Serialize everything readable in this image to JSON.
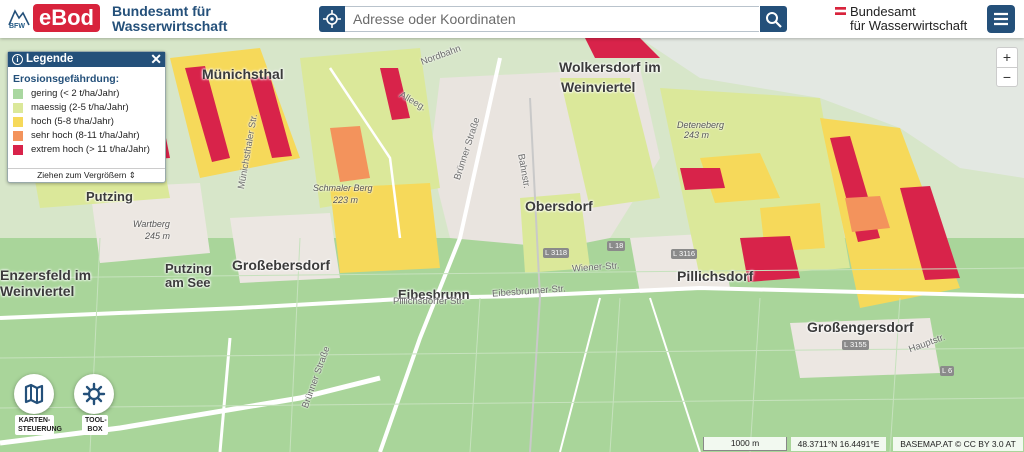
{
  "header": {
    "logo_small": "BFW",
    "app_badge": "eBod",
    "app_subtitle_line1": "Bundesamt für",
    "app_subtitle_line2": "Wasserwirtschaft",
    "search_placeholder": "Adresse oder Koordinaten",
    "agency_line1": "Bundesamt",
    "agency_line2": "für Wasserwirtschaft"
  },
  "legend": {
    "header": "Legende",
    "title": "Erosionsgefährdung:",
    "items": [
      {
        "label": "gering (< 2 t/ha/Jahr)",
        "color": "#a9d7a0"
      },
      {
        "label": "maessig (2-5 t/ha/Jahr)",
        "color": "#dbe89a"
      },
      {
        "label": "hoch (5-8 t/ha/Jahr)",
        "color": "#f6d95a"
      },
      {
        "label": "sehr hoch (8-11 t/ha/Jahr)",
        "color": "#f3935c"
      },
      {
        "label": "extrem hoch (> 11 t/ha/Jahr)",
        "color": "#d8234a"
      }
    ],
    "resize_label": "Ziehen zum Vergrößern"
  },
  "map": {
    "places": [
      "Münichsthal",
      "Wolkersdorf im",
      "Weinviertel",
      "Obersdorf",
      "Großebersdorf",
      "Pillichsdorf",
      "Großengersdorf",
      "Eibesbrunn",
      "Putzing",
      "Putzing",
      "am See",
      "Enzersfeld im",
      "Weinviertel"
    ],
    "hills": [
      "Schmaler Berg",
      "223 m",
      "Wartberg",
      "245 m",
      "Deteneberg",
      "243 m"
    ],
    "roads": [
      "Brünner Straße",
      "Bahnstr.",
      "Eibesbrunner-Str.",
      "Wiener-Str.",
      "Pillichsdorfer Str.",
      "Brünner Straße",
      "Alleeg.",
      "Nordbahn",
      "Münichsthaler Str.",
      "Hauptstr."
    ],
    "shields": [
      "L 18",
      "L 3116",
      "L 3118",
      "L 3155",
      "L 6"
    ]
  },
  "zoom": {
    "in": "+",
    "out": "−"
  },
  "tools": {
    "map_control": "KARTEN-\nSTEUERUNG",
    "toolbox": "TOOL-\nBOX"
  },
  "status": {
    "scale": "1000 m",
    "coords": "48.3711°N 16.4491°E",
    "attribution": "BASEMAP.AT © CC BY 3.0 AT"
  }
}
